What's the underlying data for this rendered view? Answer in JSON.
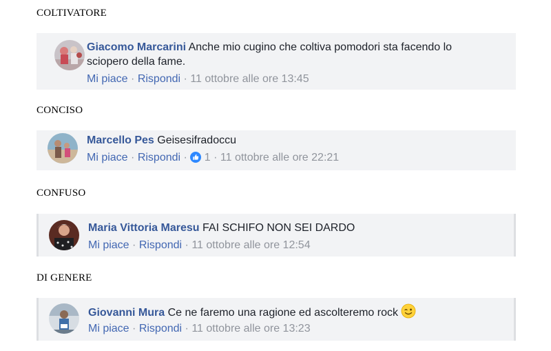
{
  "sections": [
    {
      "heading": "COLTIVATORE",
      "comment": {
        "author": "Giacomo Marcarini",
        "text_line1": "Anche mio cugino che coltiva pomodori sta facendo lo",
        "text_line2": "sciopero della fame.",
        "like_label": "Mi piace",
        "reply_label": "Rispondi",
        "separator": "·",
        "timestamp": "11 ottobre alle ore 13:45"
      }
    },
    {
      "heading": "CONCISO",
      "comment": {
        "author": "Marcello Pes",
        "text_line1": "Geisesifradoccu",
        "like_label": "Mi piace",
        "reply_label": "Rispondi",
        "separator": "·",
        "reaction_icon": "like-reaction-icon",
        "reaction_count": "1",
        "timestamp": "11 ottobre alle ore 22:21"
      }
    },
    {
      "heading": "CONFUSO",
      "comment": {
        "author": "Maria Vittoria Maresu",
        "text_line1": "FAI SCHIFO NON SEI DARDO",
        "like_label": "Mi piace",
        "reply_label": "Rispondi",
        "separator": "·",
        "timestamp": "11 ottobre alle ore 12:54"
      }
    },
    {
      "heading": "DI GENERE",
      "comment": {
        "author": "Giovanni Mura",
        "text_line1": "Ce ne faremo una ragione ed ascolteremo rock",
        "emoji": "wink-emoji-icon",
        "like_label": "Mi piace",
        "reply_label": "Rispondi",
        "separator": "·",
        "timestamp": "11 ottobre alle ore 13:23"
      }
    }
  ],
  "colors": {
    "author": "#365899",
    "link": "#4267b2",
    "meta": "#90949c",
    "comment_bg": "#f2f3f5",
    "text": "#1d2129"
  }
}
